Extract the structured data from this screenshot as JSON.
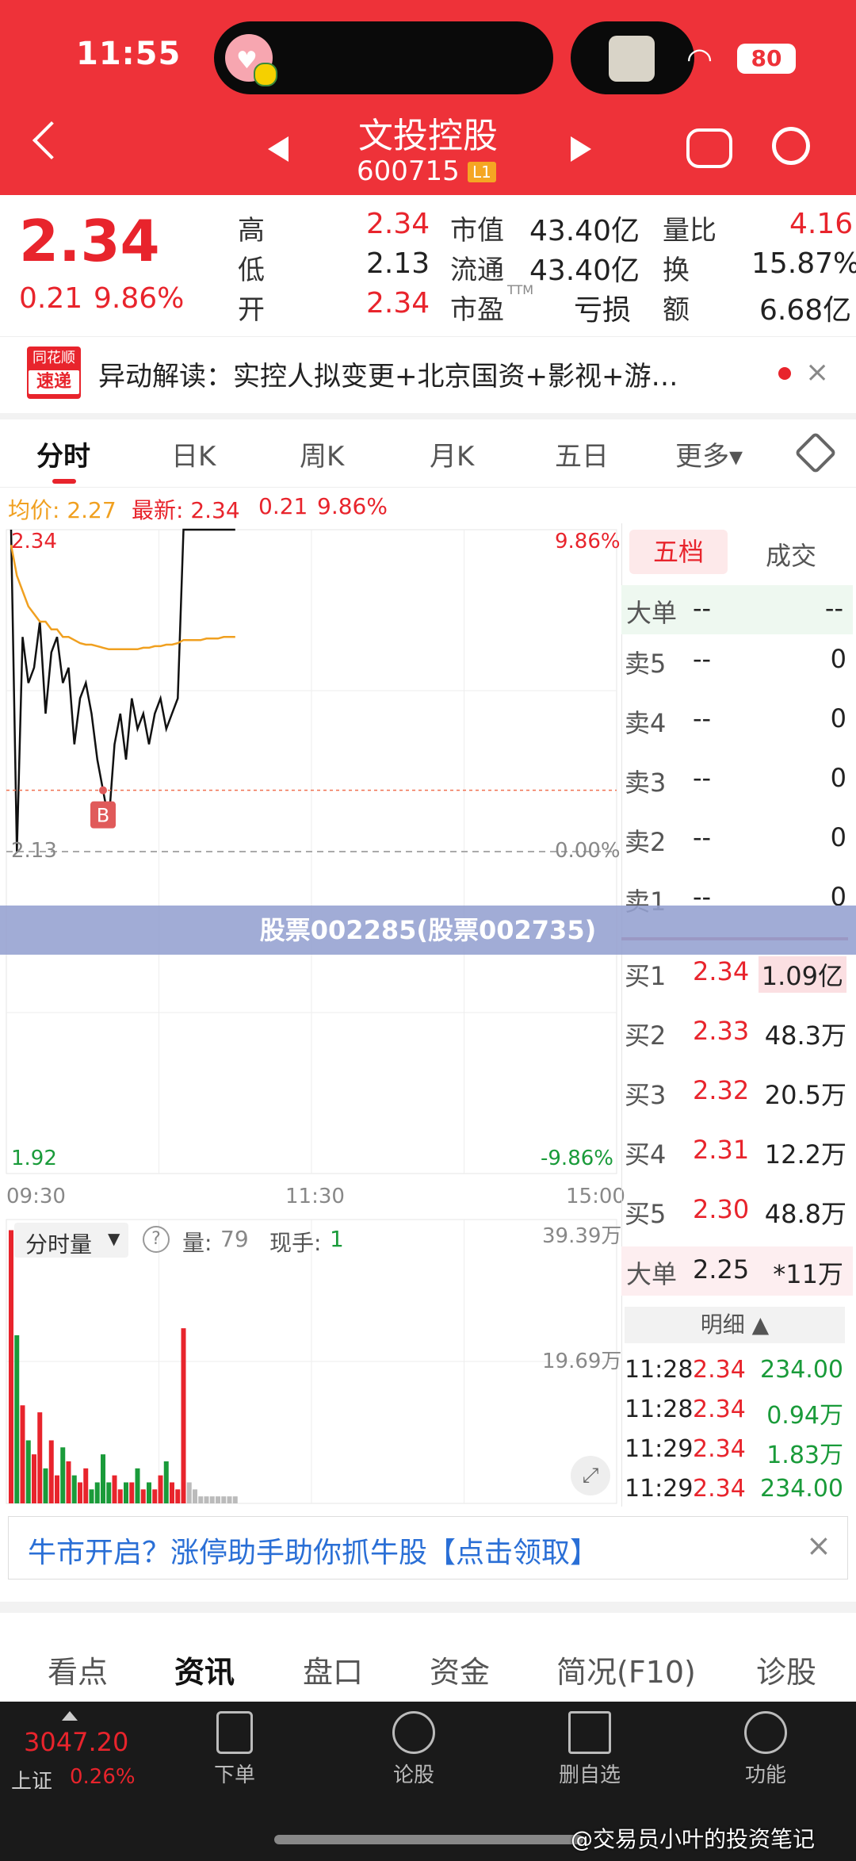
{
  "status": {
    "time": "11:55",
    "battery": "80"
  },
  "header": {
    "title": "文投控股",
    "code": "600715",
    "level_badge": "L1"
  },
  "quote": {
    "price": "2.34",
    "change": "0.21",
    "change_pct": "9.86%",
    "high_label": "高",
    "high": "2.34",
    "low_label": "低",
    "low": "2.13",
    "open_label": "开",
    "open": "2.34",
    "mcap_label": "市值",
    "mcap": "43.40亿",
    "float_label": "流通",
    "float": "43.40亿",
    "pe_label": "市盈",
    "pe_sup": "TTM",
    "pe": "亏损",
    "vol_ratio_label": "量比",
    "vol_ratio": "4.16",
    "turnover_label": "换",
    "turnover": "15.87%",
    "amount_label": "额",
    "amount": "6.68亿"
  },
  "news": {
    "logo_top": "同花顺",
    "logo_bottom": "速递",
    "text": "异动解读：实控人拟变更+北京国资+影视+游…"
  },
  "tabs": [
    "分时",
    "日K",
    "周K",
    "月K",
    "五日",
    "更多▾"
  ],
  "chart_header": {
    "avg_label": "均价: 2.27",
    "latest_label": "最新: 2.34",
    "change": "0.21",
    "pct": "9.86%"
  },
  "chart_axes": {
    "y_top": "2.34",
    "y_mid": "2.13",
    "y_bot": "1.92",
    "pct_top": "9.86%",
    "pct_mid": "0.00%",
    "pct_bot": "-9.86%",
    "t0": "09:30",
    "t1": "11:30",
    "t2": "15:00"
  },
  "chart_data": {
    "type": "line",
    "x": [
      "09:30",
      "09:33",
      "09:36",
      "09:39",
      "09:42",
      "09:45",
      "09:48",
      "09:51",
      "09:54",
      "09:57",
      "10:00",
      "10:03",
      "10:06",
      "10:09",
      "10:12",
      "10:15",
      "10:18",
      "10:21",
      "10:24",
      "10:27",
      "10:30",
      "10:33",
      "10:36",
      "10:39",
      "10:42",
      "10:45",
      "10:48",
      "10:51",
      "10:54",
      "10:57",
      "11:00",
      "11:03",
      "11:06",
      "11:09",
      "11:12",
      "11:15",
      "11:18",
      "11:21",
      "11:24",
      "11:28"
    ],
    "series": [
      {
        "name": "price",
        "values": [
          2.34,
          2.13,
          2.27,
          2.24,
          2.25,
          2.28,
          2.22,
          2.26,
          2.27,
          2.24,
          2.25,
          2.2,
          2.23,
          2.24,
          2.22,
          2.19,
          2.17,
          2.15,
          2.2,
          2.22,
          2.19,
          2.23,
          2.21,
          2.22,
          2.2,
          2.22,
          2.23,
          2.21,
          2.22,
          2.23,
          2.34,
          2.34,
          2.34,
          2.34,
          2.34,
          2.34,
          2.34,
          2.34,
          2.34,
          2.34
        ]
      },
      {
        "name": "avg",
        "values": [
          2.33,
          2.31,
          2.3,
          2.29,
          2.285,
          2.28,
          2.28,
          2.275,
          2.275,
          2.27,
          2.27,
          2.268,
          2.266,
          2.265,
          2.265,
          2.264,
          2.263,
          2.262,
          2.262,
          2.262,
          2.262,
          2.262,
          2.262,
          2.263,
          2.263,
          2.264,
          2.264,
          2.265,
          2.265,
          2.266,
          2.268,
          2.268,
          2.268,
          2.268,
          2.269,
          2.269,
          2.269,
          2.27,
          2.27,
          2.27
        ]
      }
    ],
    "ylim": [
      1.92,
      2.34
    ],
    "buy_marker": {
      "label": "B",
      "price": 2.17
    },
    "volume": {
      "ymax_label": "39.39万",
      "ymid_label": "19.69万",
      "values": [
        39,
        24,
        14,
        9,
        7,
        13,
        5,
        9,
        4,
        8,
        6,
        4,
        3,
        5,
        2,
        3,
        7,
        3,
        4,
        2,
        3,
        3,
        5,
        2,
        3,
        2,
        4,
        6,
        3,
        2,
        25,
        3,
        2,
        1,
        1,
        1,
        1,
        1,
        1,
        1
      ]
    }
  },
  "volume_panel": {
    "dropdown": "分时量",
    "qty_label": "量:",
    "qty": "79",
    "now_label": "现手:",
    "now": "1"
  },
  "depth": {
    "tab_active": "五档",
    "tab_other": "成交",
    "big_sell": {
      "label": "大单",
      "price": "--",
      "vol": "--"
    },
    "sells": [
      {
        "label": "卖5",
        "price": "--",
        "vol": "0"
      },
      {
        "label": "卖4",
        "price": "--",
        "vol": "0"
      },
      {
        "label": "卖3",
        "price": "--",
        "vol": "0"
      },
      {
        "label": "卖2",
        "price": "--",
        "vol": "0"
      },
      {
        "label": "卖1",
        "price": "--",
        "vol": "0"
      }
    ],
    "buys": [
      {
        "label": "买1",
        "price": "2.34",
        "vol": "1.09亿"
      },
      {
        "label": "买2",
        "price": "2.33",
        "vol": "48.3万"
      },
      {
        "label": "买3",
        "price": "2.32",
        "vol": "20.5万"
      },
      {
        "label": "买4",
        "price": "2.31",
        "vol": "12.2万"
      },
      {
        "label": "买5",
        "price": "2.30",
        "vol": "48.8万"
      }
    ],
    "big_buy": {
      "label": "大单",
      "price": "2.25",
      "vol": "*11万"
    },
    "detail_label": "明细 ▲",
    "ticks": [
      {
        "time": "11:28",
        "price": "2.34",
        "vol": "234.00"
      },
      {
        "time": "11:28",
        "price": "2.34",
        "vol": "0.94万"
      },
      {
        "time": "11:29",
        "price": "2.34",
        "vol": "1.83万"
      },
      {
        "time": "11:29",
        "price": "2.34",
        "vol": "234.00"
      }
    ]
  },
  "overlay_banner": "股票002285(股票002735)",
  "ad": {
    "text": "牛市开启？涨停助手助你抓牛股【点击领取】"
  },
  "info_tabs": [
    "看点",
    "资讯",
    "盘口",
    "资金",
    "简况(F10)",
    "诊股"
  ],
  "bottom_nav": {
    "index_value": "3047.20",
    "index_name": "上证",
    "index_pct": "0.26%",
    "items": [
      "下单",
      "论股",
      "删自选",
      "功能"
    ]
  },
  "watermark": "@交易员小叶的投资笔记",
  "colors": {
    "brand": "#ee3239",
    "up": "#e8242c",
    "down": "#1a9b3a",
    "avg": "#f0a020"
  }
}
